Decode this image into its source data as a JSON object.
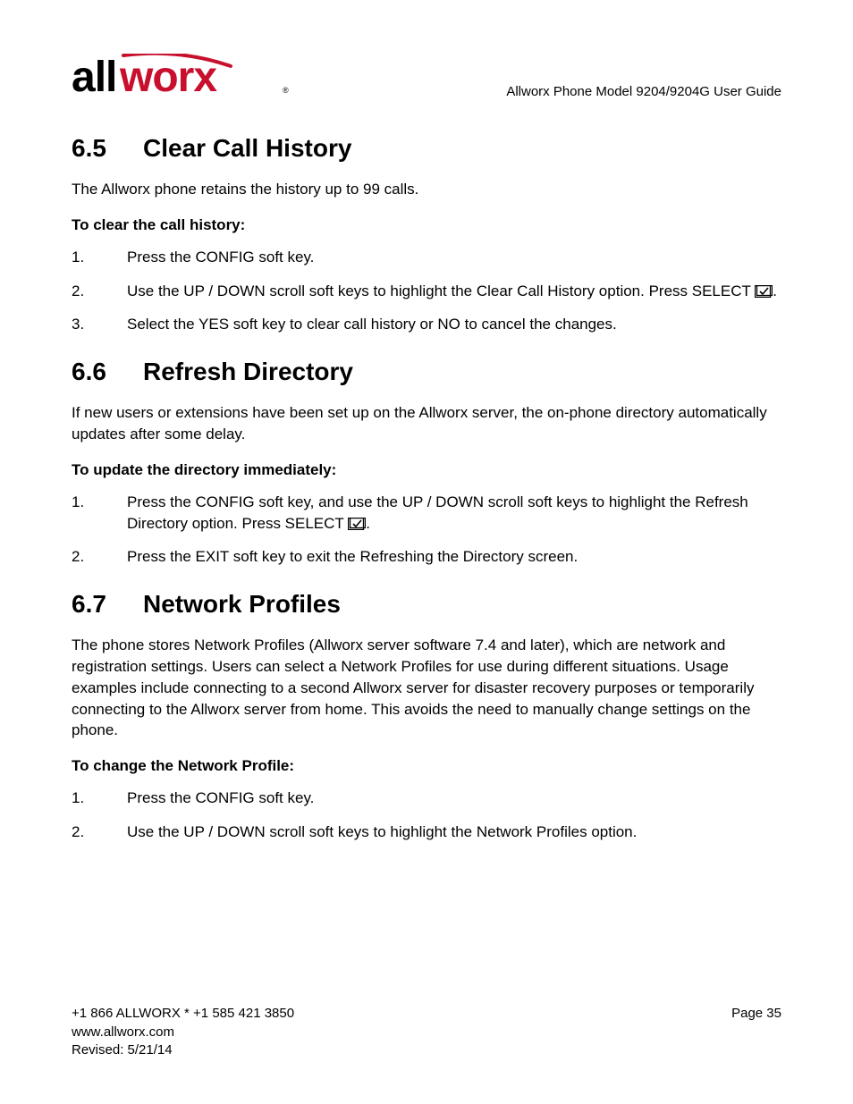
{
  "header": {
    "doc_title": "Allworx Phone Model 9204/9204G User Guide",
    "logo_text": "allworx"
  },
  "sections": {
    "s65": {
      "num": "6.5",
      "title": "Clear Call History",
      "intro": "The Allworx phone retains the history up to 99 calls.",
      "lead": "To clear the call history:",
      "steps": {
        "1": "Press the CONFIG soft key.",
        "2a": "Use the UP / DOWN scroll soft keys to highlight the Clear Call History option. Press SELECT ",
        "2b": ".",
        "3": "Select the YES soft key to clear call history or NO to cancel the changes."
      }
    },
    "s66": {
      "num": "6.6",
      "title": "Refresh Directory",
      "intro": "If new users or extensions have been set up on the Allworx server, the on-phone directory automatically updates after some delay.",
      "lead": "To update the directory immediately:",
      "steps": {
        "1a": "Press the CONFIG soft key, and use the UP / DOWN scroll soft keys to highlight the Refresh Directory option. Press SELECT ",
        "1b": ".",
        "2": "Press the EXIT soft key to exit the Refreshing the Directory screen."
      }
    },
    "s67": {
      "num": "6.7",
      "title": "Network Profiles",
      "intro": "The phone stores Network Profiles (Allworx server software 7.4 and later), which are network and registration settings. Users can select a Network Profiles for use during different situations. Usage examples include connecting to a second Allworx server for disaster recovery purposes or temporarily connecting to the Allworx server from home. This avoids the need to manually change settings on the phone.",
      "lead": "To change the Network Profile:",
      "steps": {
        "1": "Press the CONFIG soft key.",
        "2": "Use the UP / DOWN scroll soft keys to highlight the Network Profiles option."
      }
    }
  },
  "footer": {
    "phone_line": "+1 866 ALLWORX * +1 585 421 3850",
    "url": "www.allworx.com",
    "revised": "Revised: 5/21/14",
    "page": "Page 35"
  }
}
